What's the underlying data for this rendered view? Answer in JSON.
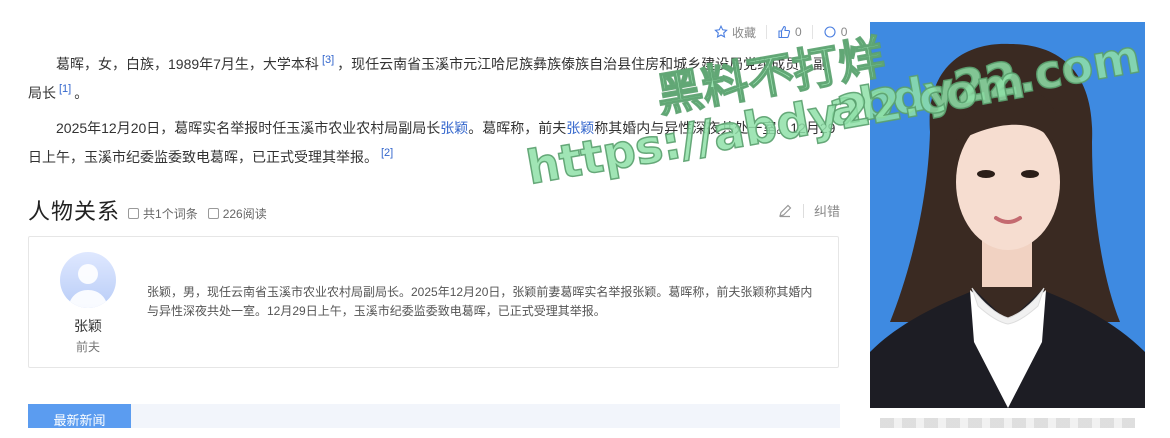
{
  "toolbar": {
    "favorite_label": "收藏",
    "like_count": "0",
    "share_count": "0"
  },
  "intro": {
    "p1_text": "葛晖，女，白族，1989年7月生，大学本科",
    "p1_ref": "[3]",
    "p1_text2": "，现任云南省玉溪市元江哈尼族彝族傣族自治县住房和城乡建设局党组成员、副局长",
    "p1_ref2": "[1]",
    "p1_end": "。",
    "p2_text": "2025年12月20日，葛晖实名举报时任玉溪市农业农村局副局长",
    "p2_link1": "张颖",
    "p2_text2": "。葛晖称，前夫",
    "p2_link2": "张颖",
    "p2_text3": "称其婚内与异性深夜共处一室。12月29日上午，玉溪市纪委监委致电葛晖，已正式受理其举报。",
    "p2_ref": "[2]"
  },
  "relations": {
    "title": "人物关系",
    "entries_count": "共1个词条",
    "reads": "226阅读",
    "report_label": "纠错",
    "person": {
      "name": "张颖",
      "relation": "前夫",
      "description": "张颖，男，现任云南省玉溪市农业农村局副局长。2025年12月20日，张颖前妻葛晖实名举报张颖。葛晖称，前夫张颖称其婚内与异性深夜共处一室。12月29日上午，玉溪市纪委监委致电葛晖，已正式受理其举报。"
    }
  },
  "news": {
    "tab_label": "最新新闻"
  },
  "watermark": {
    "line1": "黑料不打烊",
    "line2": "abdy22.com",
    "line3": "https://abdy22.com"
  },
  "colors": {
    "link": "#3366cc",
    "photo_bg": "#3e8ae1",
    "tab": "#5b9cf0",
    "watermark_fill": "#8fe0a8"
  }
}
